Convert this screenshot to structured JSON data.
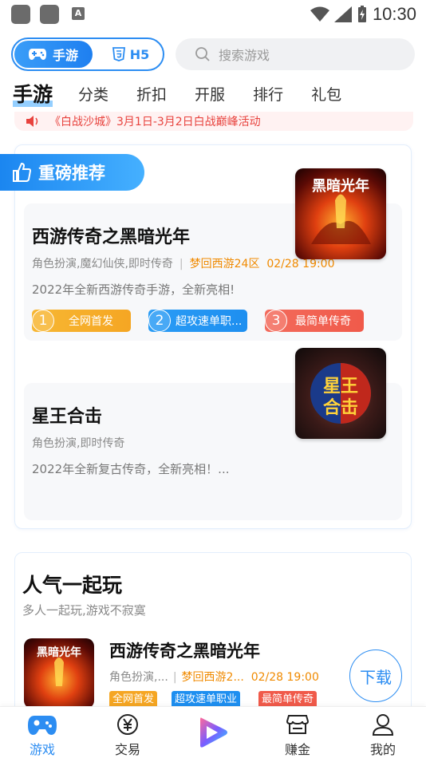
{
  "status_bar": {
    "time": "10:30",
    "a_label": "A"
  },
  "top": {
    "seg_active": "手游",
    "seg_other": "H5",
    "search_placeholder": "搜索游戏"
  },
  "tabs": [
    "手游",
    "分类",
    "折扣",
    "开服",
    "排行",
    "礼包"
  ],
  "notice": "《白战沙城》3月1日-3月2日白战巅峰活动",
  "recommend": {
    "badge": "重磅推荐",
    "games": [
      {
        "title": "西游传奇之黑暗光年",
        "genres": "角色扮演,魔幻仙侠,即时传奇",
        "server": "梦回西游24区",
        "time": "02/28 19:00",
        "desc": "2022年全新西游传奇手游，全新亮相!",
        "tags": [
          {
            "num": "1",
            "label": "全网首发",
            "color": "#f5a623"
          },
          {
            "num": "2",
            "label": "超攻速单职...",
            "color": "#1e8ff0"
          },
          {
            "num": "3",
            "label": "最简单传奇",
            "color": "#f05a4a"
          }
        ]
      },
      {
        "title": "星王合击",
        "genres": "角色扮演,即时传奇",
        "desc": "2022年全新复古传奇，全新亮相！..."
      }
    ]
  },
  "popular": {
    "title": "人气一起玩",
    "subtitle": "多人一起玩,游戏不寂寞",
    "game": {
      "name": "西游传奇之黑暗光年",
      "genres": "角色扮演,...",
      "server": "梦回西游2...",
      "time": "02/28 19:00",
      "tags": [
        {
          "label": "全网首发",
          "color": "#f5a623"
        },
        {
          "label": "超攻速单职业",
          "color": "#1e8ff0"
        },
        {
          "label": "最简单传奇",
          "color": "#f05a4a"
        }
      ],
      "download": "下载"
    }
  },
  "bottom_nav": [
    {
      "label": "游戏",
      "icon": "gamepad-icon",
      "active": true
    },
    {
      "label": "交易",
      "icon": "yen-coin-icon",
      "active": false
    },
    {
      "label": "",
      "icon": "play-icon",
      "active": false
    },
    {
      "label": "赚金",
      "icon": "shop-icon",
      "active": false
    },
    {
      "label": "我的",
      "icon": "user-icon",
      "active": false
    }
  ],
  "colors": {
    "accent": "#2c8df2",
    "orange": "#f08a00",
    "notice": "#e8433e"
  }
}
